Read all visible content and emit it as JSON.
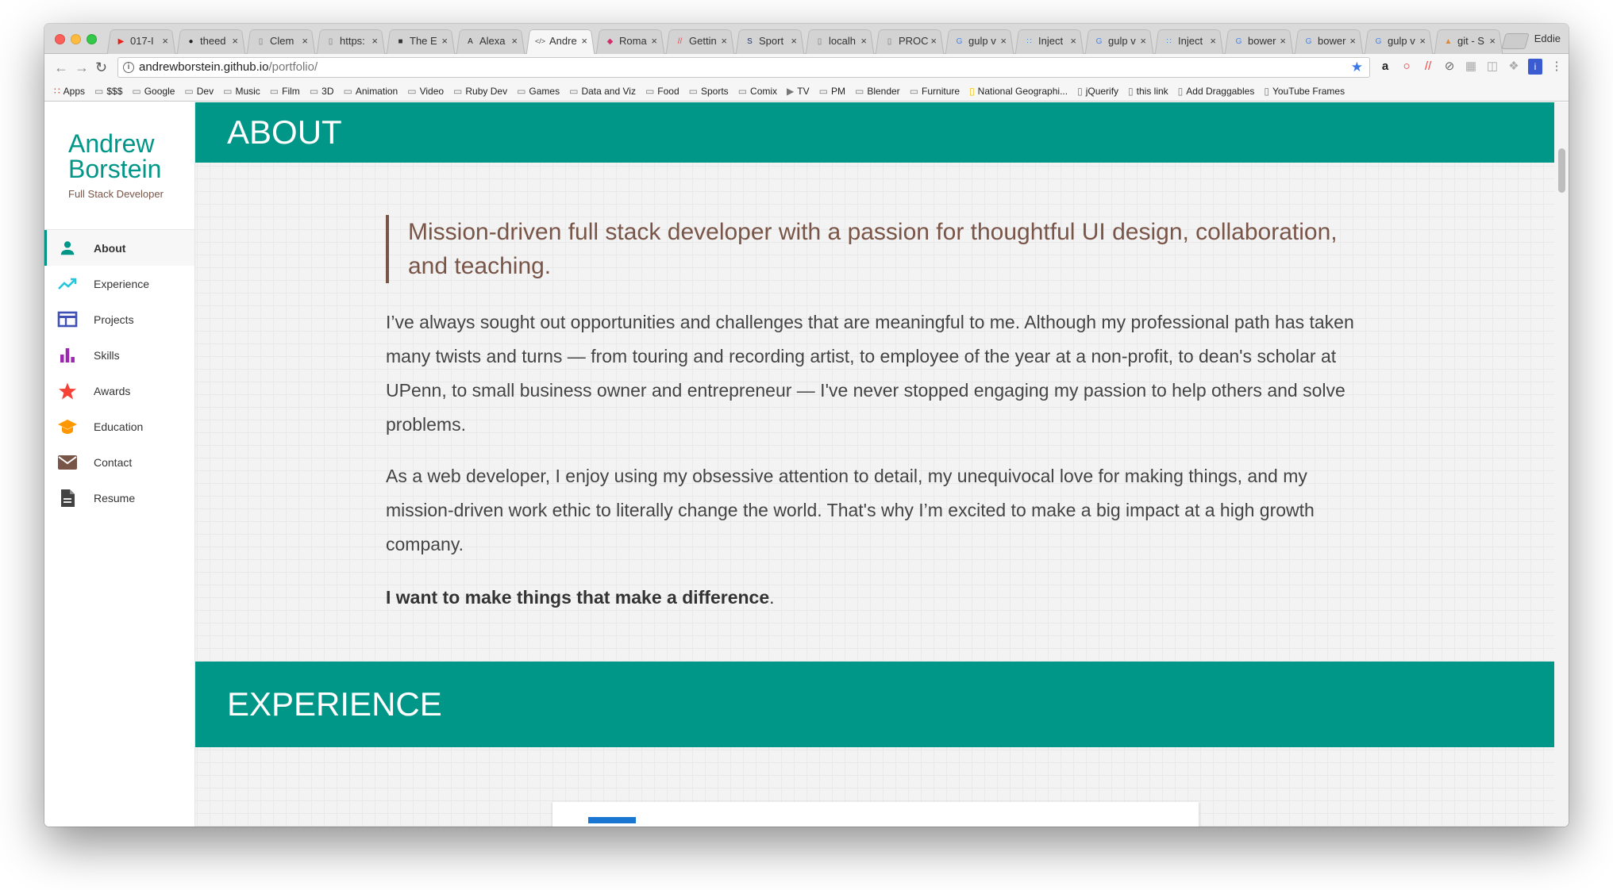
{
  "browser": {
    "tabs": [
      {
        "icon": "youtube-icon",
        "label": "017-I"
      },
      {
        "icon": "github-icon",
        "label": "theed"
      },
      {
        "icon": "page-icon",
        "label": "Clem"
      },
      {
        "icon": "page-icon",
        "label": "https:"
      },
      {
        "icon": "square-icon",
        "label": "The E"
      },
      {
        "icon": "ar-icon",
        "label": "Alexa"
      },
      {
        "icon": "code-icon",
        "label": "Andre"
      },
      {
        "icon": "gem-icon",
        "label": "Roma"
      },
      {
        "icon": "slash-icon",
        "label": "Gettin"
      },
      {
        "icon": "si-icon",
        "label": "Sport"
      },
      {
        "icon": "page-icon",
        "label": "localh"
      },
      {
        "icon": "page-icon",
        "label": "PROC"
      },
      {
        "icon": "google-icon",
        "label": "gulp v"
      },
      {
        "icon": "dots-icon",
        "label": "Inject"
      },
      {
        "icon": "google-icon",
        "label": "gulp v"
      },
      {
        "icon": "dots-icon",
        "label": "Inject"
      },
      {
        "icon": "google-icon",
        "label": "bower"
      },
      {
        "icon": "google-icon",
        "label": "bower"
      },
      {
        "icon": "google-icon",
        "label": "gulp v"
      },
      {
        "icon": "git-icon",
        "label": "git - S"
      }
    ],
    "active_tab_index": 6,
    "profile_name": "Eddie",
    "url_host": "andrewborstein.github.io",
    "url_path": "/portfolio/",
    "bookmarks": [
      {
        "icon": "apps-icon",
        "label": "Apps"
      },
      {
        "icon": "folder-icon",
        "label": "$$$"
      },
      {
        "icon": "folder-icon",
        "label": "Google"
      },
      {
        "icon": "folder-icon",
        "label": "Dev"
      },
      {
        "icon": "folder-icon",
        "label": "Music"
      },
      {
        "icon": "folder-icon",
        "label": "Film"
      },
      {
        "icon": "folder-icon",
        "label": "3D"
      },
      {
        "icon": "folder-icon",
        "label": "Animation"
      },
      {
        "icon": "folder-icon",
        "label": "Video"
      },
      {
        "icon": "folder-icon",
        "label": "Ruby Dev"
      },
      {
        "icon": "folder-icon",
        "label": "Games"
      },
      {
        "icon": "folder-icon",
        "label": "Data and Viz"
      },
      {
        "icon": "folder-icon",
        "label": "Food"
      },
      {
        "icon": "folder-icon",
        "label": "Sports"
      },
      {
        "icon": "folder-icon",
        "label": "Comix"
      },
      {
        "icon": "play-icon",
        "label": "TV"
      },
      {
        "icon": "folder-icon",
        "label": "PM"
      },
      {
        "icon": "folder-icon",
        "label": "Blender"
      },
      {
        "icon": "folder-icon",
        "label": "Furniture"
      },
      {
        "icon": "natgeo-icon",
        "label": "National Geographi..."
      },
      {
        "icon": "page-icon",
        "label": "jQuerify"
      },
      {
        "icon": "page-icon",
        "label": "this link"
      },
      {
        "icon": "page-icon",
        "label": "Add Draggables"
      },
      {
        "icon": "page-icon",
        "label": "YouTube Frames"
      }
    ]
  },
  "sidebar": {
    "name": "Andrew Borstein",
    "tagline": "Full Stack Developer",
    "items": [
      {
        "label": "About",
        "icon": "person-icon",
        "color": "#009688",
        "active": true
      },
      {
        "label": "Experience",
        "icon": "trending-up-icon",
        "color": "#26c6da",
        "active": false
      },
      {
        "label": "Projects",
        "icon": "web-window-icon",
        "color": "#3f51b5",
        "active": false
      },
      {
        "label": "Skills",
        "icon": "bar-chart-icon",
        "color": "#9c27b0",
        "active": false
      },
      {
        "label": "Awards",
        "icon": "star-icon",
        "color": "#f44336",
        "active": false
      },
      {
        "label": "Education",
        "icon": "graduation-cap-icon",
        "color": "#ff9800",
        "active": false
      },
      {
        "label": "Contact",
        "icon": "mail-icon",
        "color": "#795548",
        "active": false
      },
      {
        "label": "Resume",
        "icon": "document-icon",
        "color": "#424242",
        "active": false
      }
    ]
  },
  "about": {
    "heading": "ABOUT",
    "quote": "Mission-driven full stack developer with a passion for thoughtful UI design, collaboration, and teaching.",
    "paragraph1": "I’ve always sought out opportunities and challenges that are meaningful to me. Although my professional path has taken many twists and turns — from touring and recording artist, to employee of the year at a non-profit, to dean's scholar at UPenn, to small business owner and entrepreneur — I've never stopped engaging my passion to help others and solve problems.",
    "paragraph2": "As a web developer, I enjoy using my obsessive attention to detail, my unequivocal love for making things, and my mission-driven work ethic to literally change the world. That's why I’m excited to make a big impact at a high growth company.",
    "closing": "I want to make things that make a difference",
    "closing_punct": "."
  },
  "experience": {
    "heading": "EXPERIENCE"
  },
  "colors": {
    "teal": "#009688",
    "brown": "#795548",
    "blue": "#1976d2"
  }
}
